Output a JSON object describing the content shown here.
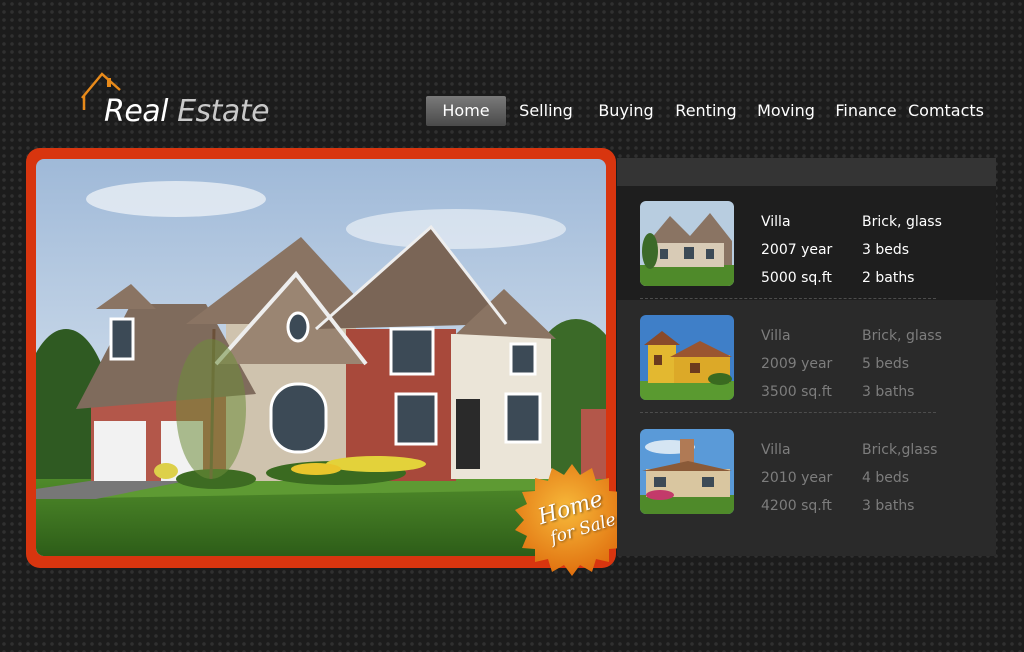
{
  "logo": {
    "word1": "Real",
    "word2": "Estate"
  },
  "nav": [
    {
      "label": "Home",
      "active": true
    },
    {
      "label": "Selling",
      "active": false
    },
    {
      "label": "Buying",
      "active": false
    },
    {
      "label": "Renting",
      "active": false
    },
    {
      "label": "Moving",
      "active": false
    },
    {
      "label": "Finance",
      "active": false
    },
    {
      "label": "Comtacts",
      "active": false
    }
  ],
  "badge": {
    "line1": "Home",
    "line2": "for Sale"
  },
  "colors": {
    "accent": "#d8350f",
    "badge": "#f2a01c",
    "logo_roof": "#e88a1a"
  },
  "listings": [
    {
      "type": "Villa",
      "year": "2007 year",
      "area": "5000 sq.ft",
      "material": "Brick, glass",
      "beds": "3 beds",
      "baths": "2 baths"
    },
    {
      "type": "Villa",
      "year": "2009 year",
      "area": "3500 sq.ft",
      "material": "Brick, glass",
      "beds": "5 beds",
      "baths": "3 baths"
    },
    {
      "type": "Villa",
      "year": "2010 year",
      "area": "4200 sq.ft",
      "material": "Brick,glass",
      "beds": "4 beds",
      "baths": "3 baths"
    }
  ]
}
